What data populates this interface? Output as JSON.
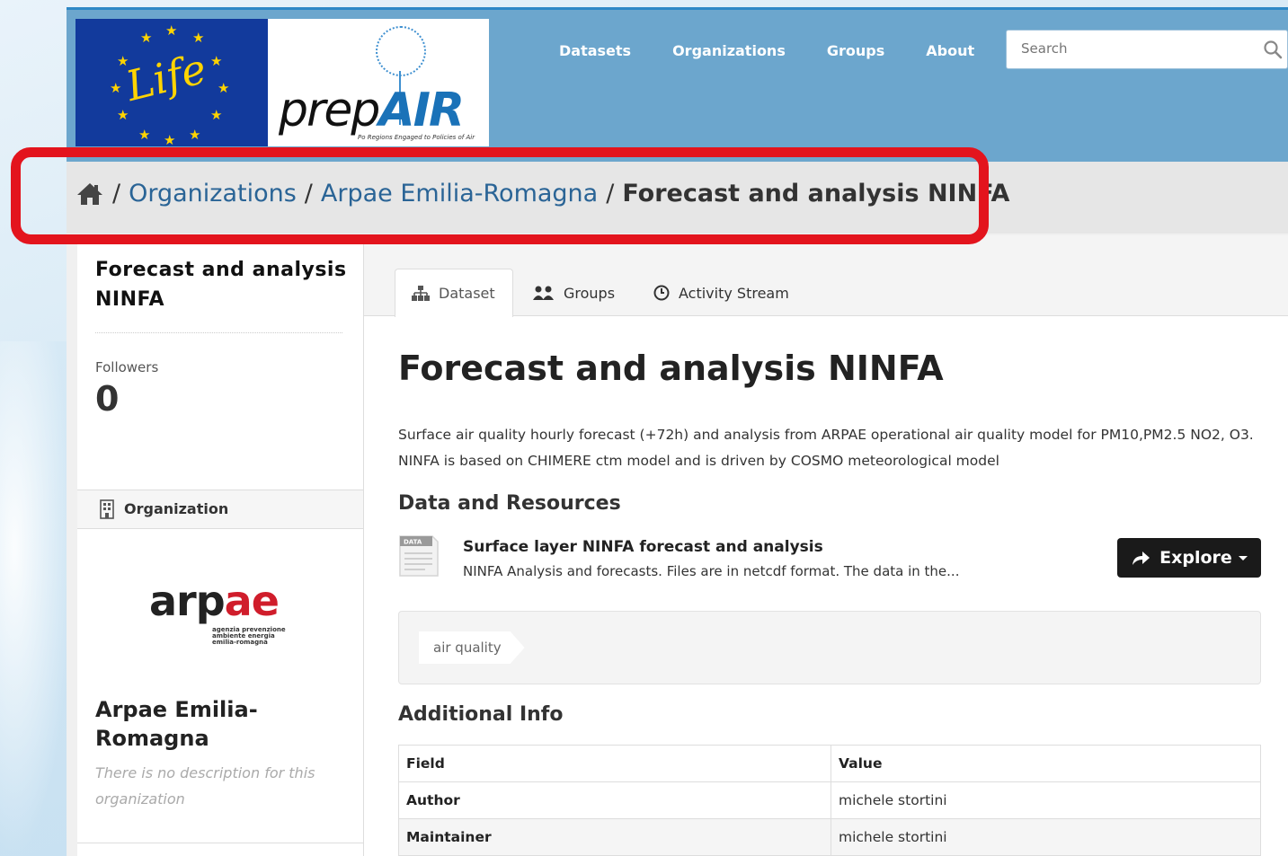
{
  "nav": {
    "items": [
      "Datasets",
      "Organizations",
      "Groups",
      "About"
    ],
    "search_placeholder": "Search"
  },
  "logos": {
    "life_text": "Life",
    "prep_text": "prep",
    "air_text": "AIR",
    "prep_tagline": "Po Regions Engaged to Policies of Air"
  },
  "breadcrumb": {
    "items": [
      "Organizations",
      "Arpae Emilia-Romagna"
    ],
    "current": "Forecast and analysis NINFA"
  },
  "sidebar": {
    "title": "Forecast and analysis NINFA",
    "followers_label": "Followers",
    "followers_value": "0",
    "org_heading": "Organization",
    "org_logo_text": "arp",
    "org_logo_accent": "ae",
    "org_logo_subtext": "agenzia prevenzione ambiente energia emilia-romagna",
    "org_name": "Arpae Emilia-Romagna",
    "org_description": "There is no description for this organization"
  },
  "tabs": [
    "Dataset",
    "Groups",
    "Activity Stream"
  ],
  "dataset": {
    "title": "Forecast and analysis NINFA",
    "notes": "Surface air quality hourly forecast (+72h) and analysis from ARPAE operational air quality model for PM10,PM2.5 NO2, O3. NINFA is based on CHIMERE ctm model and is driven by COSMO meteorological model",
    "resources_heading": "Data and Resources",
    "resource": {
      "icon_label": "DATA",
      "title": "Surface layer NINFA forecast and analysis",
      "description": "NINFA Analysis and forecasts. Files are in netcdf format. The data in the...",
      "button": "Explore"
    },
    "tags": [
      "air quality"
    ],
    "additional_heading": "Additional Info",
    "table": {
      "headers": [
        "Field",
        "Value"
      ],
      "rows": [
        [
          "Author",
          "michele stortini"
        ],
        [
          "Maintainer",
          "michele stortini"
        ]
      ]
    }
  },
  "colors": {
    "masthead": "#6ca6cd",
    "link": "#2a6496",
    "highlight": "#e3141d",
    "explore_button": "#1a1a1a"
  }
}
